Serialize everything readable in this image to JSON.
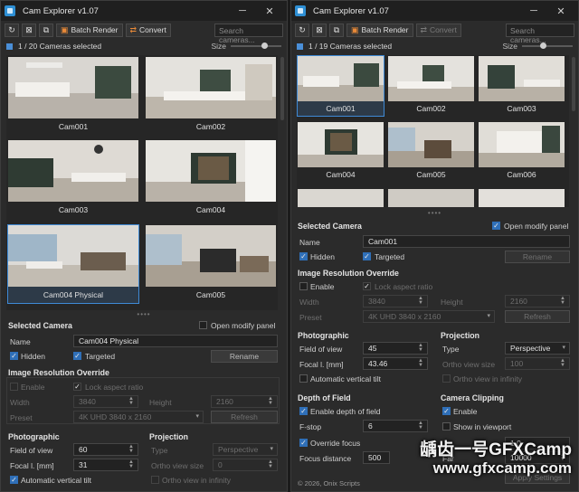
{
  "left": {
    "title": "Cam Explorer v1.07",
    "toolbar": {
      "batch_label": "Batch Render",
      "convert_label": "Convert",
      "search_placeholder": "Search cameras..."
    },
    "selection": "1 / 20 Cameras selected",
    "size_label": "Size",
    "cams": [
      "Cam001",
      "Cam002",
      "Cam003",
      "Cam004",
      "Cam004 Physical",
      "Cam005"
    ],
    "selected_camera": {
      "title": "Selected Camera",
      "open_modify": "Open modify panel",
      "name_label": "Name",
      "name_value": "Cam004 Physical",
      "hidden": "Hidden",
      "targeted": "Targeted",
      "rename": "Rename"
    },
    "resolution": {
      "title": "Image Resolution Override",
      "enable": "Enable",
      "lock": "Lock aspect ratio",
      "width_label": "Width",
      "width": "3840",
      "height_label": "Height",
      "height": "2160",
      "preset_label": "Preset",
      "preset": "4K UHD 3840 x 2160",
      "refresh": "Refresh"
    },
    "photographic": {
      "title": "Photographic",
      "fov_label": "Field of view",
      "fov": "60",
      "focal_label": "Focal l. [mm]",
      "focal": "31",
      "auto_tilt": "Automatic vertical tilt"
    },
    "projection": {
      "title": "Projection",
      "type_label": "Type",
      "type": "Perspective",
      "ortho_label": "Ortho view size",
      "ortho": "0",
      "ortho_inf": "Ortho view in infinity"
    }
  },
  "right": {
    "title": "Cam Explorer v1.07",
    "toolbar": {
      "batch_label": "Batch Render",
      "convert_label": "Convert",
      "search_placeholder": "Search cameras..."
    },
    "selection": "1 / 19 Cameras selected",
    "size_label": "Size",
    "cams": [
      "Cam001",
      "Cam002",
      "Cam003",
      "Cam004",
      "Cam005",
      "Cam006"
    ],
    "selected_camera": {
      "title": "Selected Camera",
      "open_modify": "Open modify panel",
      "name_label": "Name",
      "name_value": "Cam001",
      "hidden": "Hidden",
      "targeted": "Targeted",
      "rename": "Rename"
    },
    "resolution": {
      "title": "Image Resolution Override",
      "enable": "Enable",
      "lock": "Lock aspect ratio",
      "width_label": "Width",
      "width": "3840",
      "height_label": "Height",
      "height": "2160",
      "preset_label": "Preset",
      "preset": "4K UHD 3840 x 2160",
      "refresh": "Refresh"
    },
    "photographic": {
      "title": "Photographic",
      "fov_label": "Field of view",
      "fov": "45",
      "focal_label": "Focal l. [mm]",
      "focal": "43.46",
      "auto_tilt": "Automatic vertical tilt"
    },
    "projection": {
      "title": "Projection",
      "type_label": "Type",
      "type": "Perspective",
      "ortho_label": "Ortho view size",
      "ortho": "100",
      "ortho_inf": "Ortho view in infinity"
    },
    "dof": {
      "title": "Depth of Field",
      "enable": "Enable depth of field",
      "fstop_label": "F-stop",
      "fstop": "6",
      "override_focus": "Override focus",
      "focus_label": "Focus distance",
      "focus": "500"
    },
    "clipping": {
      "title": "Camera Clipping",
      "enable": "Enable",
      "show": "Show in viewport",
      "near": "1.0",
      "far_label": "Far",
      "far": "10000"
    },
    "apply": "Apply Settings",
    "footer": "© 2026, Onix Scripts"
  },
  "watermark": {
    "line1": "龋齿一号GFXCamp",
    "line2": "www.gfxcamp.com"
  },
  "icons": {
    "refresh": "refresh-icon",
    "clear": "clear-icon",
    "duplicate": "duplicate-icon"
  },
  "colors": {
    "accent": "#3f8ad6",
    "convert_orange": "#e98a38",
    "bg": "#2b2b2b"
  }
}
